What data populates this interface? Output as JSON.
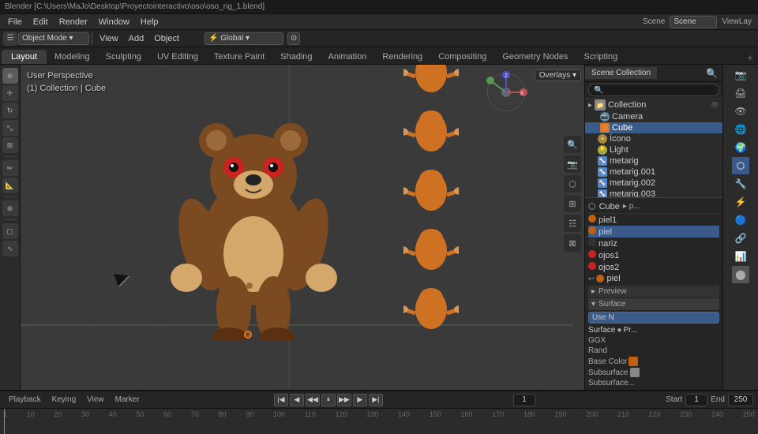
{
  "window": {
    "title": "Blender [C:\\Users\\MaJo\\Desktop\\Proyectointeractivo\\oso\\oso_rig_1.blend]"
  },
  "menubar": {
    "items": [
      "File",
      "Edit",
      "Render",
      "Window",
      "Help"
    ]
  },
  "editor_modes": [
    "Object Mode",
    "View",
    "Add",
    "Object"
  ],
  "header_tabs": [
    "Layout",
    "Modeling",
    "Sculpting",
    "UV Editing",
    "Texture Paint",
    "Shading",
    "Animation",
    "Rendering",
    "Compositing",
    "Geometry Nodes",
    "Scripting"
  ],
  "active_tab": "Layout",
  "viewport": {
    "mode": "User Perspective",
    "collection_path": "(1) Collection | Cube",
    "overlay_btn": "Overlays",
    "gizmo_btn": "Gizmo"
  },
  "timeline": {
    "playback": "Playback",
    "keying": "Keying",
    "view": "View",
    "marker": "Marker",
    "frame_current": "1",
    "frame_start": "1",
    "frame_end": "250",
    "frame_end_label": "End",
    "frame_start_label": "Start",
    "ruler_marks": [
      "1",
      "10",
      "20",
      "30",
      "40",
      "50",
      "60",
      "70",
      "80",
      "90",
      "100",
      "110",
      "120",
      "130",
      "140",
      "150",
      "160",
      "170",
      "180",
      "190",
      "200",
      "210",
      "220",
      "230",
      "240",
      "250"
    ]
  },
  "scene_collection": {
    "title": "Scene Collection",
    "search_placeholder": "",
    "items": [
      {
        "label": "Collection",
        "type": "collection",
        "indent": 1
      },
      {
        "label": "Camera",
        "type": "camera",
        "indent": 2
      },
      {
        "label": "Cube",
        "type": "cube",
        "indent": 2
      },
      {
        "label": "Ícono",
        "type": "icon",
        "indent": 2
      },
      {
        "label": "Light",
        "type": "light",
        "indent": 2
      },
      {
        "label": "metarig",
        "type": "armature",
        "indent": 2
      },
      {
        "label": "metarig.001",
        "type": "armature",
        "indent": 2
      },
      {
        "label": "metarig.002",
        "type": "armature",
        "indent": 2
      },
      {
        "label": "metarig.003",
        "type": "armature",
        "indent": 2
      }
    ]
  },
  "properties": {
    "active_object": "Cube",
    "search_placeholder": "",
    "material_label": "piel",
    "materials": [
      {
        "name": "piel1",
        "color": "#c06010"
      },
      {
        "name": "piel",
        "color": "#c06010",
        "active": true
      },
      {
        "name": "nariz",
        "color": "#333333"
      },
      {
        "name": "ojos1",
        "color": "#cc2222"
      },
      {
        "name": "ojos2",
        "color": "#cc2222"
      },
      {
        "name": "piel",
        "color": "#c06010"
      }
    ],
    "preview_label": "Preview",
    "surface_label": "Surface",
    "use_nodes_btn": "Use N",
    "surface_row": "Surface",
    "surface_value": "Pr...",
    "roughness_label": "GGX",
    "random_label": "Rand",
    "base_color_label": "Base Color",
    "subsurface_label": "Subsurface",
    "subsurface2_label": "Subsurface..."
  },
  "left_tools": [
    "cursor",
    "move",
    "rotate",
    "scale",
    "transform",
    "annotate",
    "measure",
    "add"
  ],
  "icons": {
    "search": "🔍",
    "camera": "📷",
    "cube": "⬜",
    "light": "💡",
    "armature": "🦴",
    "collection": "📁",
    "cursor_icon": "⊕",
    "move_icon": "✛",
    "arrow": "▶"
  }
}
